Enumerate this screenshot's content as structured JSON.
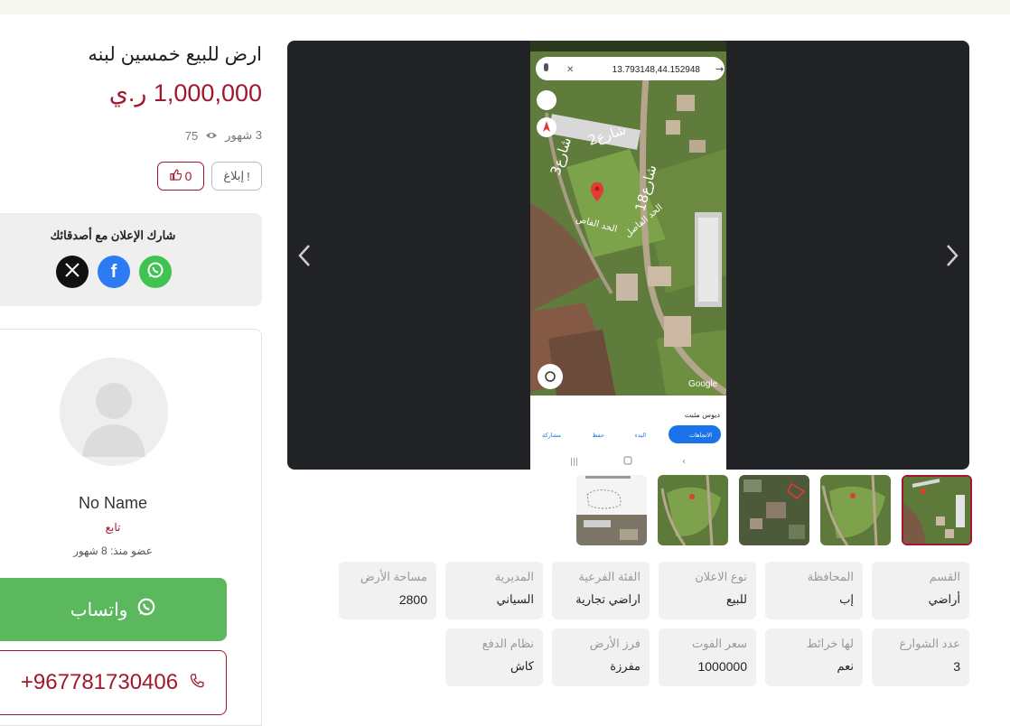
{
  "ad": {
    "title": "ارض للبيع خمسين لبنه",
    "price": "1,000,000 ر.ي",
    "age": "3 شهور",
    "views": "75",
    "report_label": "إبلاغ",
    "likes": "0"
  },
  "share": {
    "title": "شارك الإعلان مع أصدقائك",
    "icons": [
      "whatsapp-icon",
      "facebook-icon",
      "x-icon"
    ]
  },
  "seller": {
    "name": "No Name",
    "role": "تابع",
    "member_since": "عضو منذ: 8 شهور",
    "whatsapp_label": "واتساب",
    "phone": "+967781730406"
  },
  "screenshot": {
    "search_coords": "13.793148,44.152948",
    "place_name": "ديوس مثبت",
    "btn_directions": "الاتجاهات",
    "btn_start": "البدء",
    "btn_save": "حفظ",
    "btn_share": "مشاركة",
    "street_2": "شارع2",
    "street_3": "شارع3",
    "street_18": "شارع18",
    "boundary_1": "الحد الفاص",
    "boundary_2": "الحد الفاصل",
    "google": "Google"
  },
  "gallery": {
    "thumbnail_count": 5,
    "active_index": 0
  },
  "details": [
    {
      "label": "القسم",
      "value": "أراضي"
    },
    {
      "label": "المحافظة",
      "value": "إب"
    },
    {
      "label": "نوع الاعلان",
      "value": "للبيع"
    },
    {
      "label": "الفئة الفرعية",
      "value": "اراضي تجارية"
    },
    {
      "label": "المديرية",
      "value": "السياني"
    },
    {
      "label": "مساحة الأرض",
      "value": "2800"
    },
    {
      "label": "عدد الشوارع",
      "value": "3"
    },
    {
      "label": "لها خرائط",
      "value": "نعم"
    },
    {
      "label": "سعر الفوت",
      "value": "1000000"
    },
    {
      "label": "فرز الأرض",
      "value": "مفرزة"
    },
    {
      "label": "نظام الدفع",
      "value": "كاش"
    }
  ],
  "colors": {
    "accent": "#a0182d",
    "whatsapp": "#5cb85c",
    "gallery_bg": "#212327"
  }
}
